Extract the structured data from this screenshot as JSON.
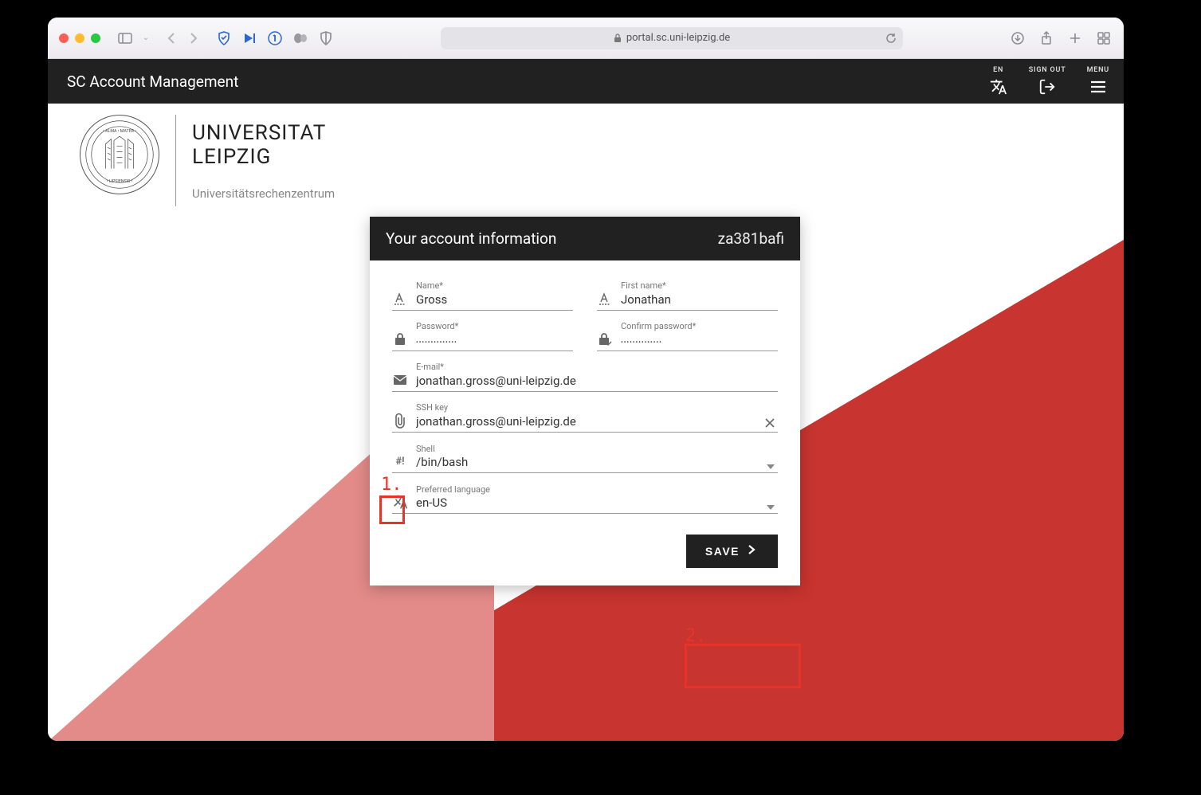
{
  "browser": {
    "url": "portal.sc.uni-leipzig.de"
  },
  "header": {
    "app_title": "SC Account Management",
    "lang_label": "EN",
    "signout_label": "SIGN OUT",
    "menu_label": "MENU"
  },
  "logo": {
    "line1": "UNIVERSITAT",
    "line2": "LEIPZIG",
    "subtitle": "Universitätsrechenzentrum"
  },
  "card": {
    "title": "Your account information",
    "account_id": "za381bafi",
    "fields": {
      "name_label": "Name*",
      "name_value": "Gross",
      "firstname_label": "First name*",
      "firstname_value": "Jonathan",
      "password_label": "Password*",
      "password_value": "••••••••••••••",
      "confirm_password_label": "Confirm password*",
      "confirm_password_value": "••••••••••••••",
      "email_label": "E-mail*",
      "email_value": "jonathan.gross@uni-leipzig.de",
      "sshkey_label": "SSH key",
      "sshkey_value": "jonathan.gross@uni-leipzig.de",
      "shell_label": "Shell",
      "shell_value": "/bin/bash",
      "lang_label": "Preferred language",
      "lang_value": "en-US"
    },
    "save_label": "SAVE"
  },
  "annotations": {
    "label1": "1.",
    "label2": "2."
  }
}
